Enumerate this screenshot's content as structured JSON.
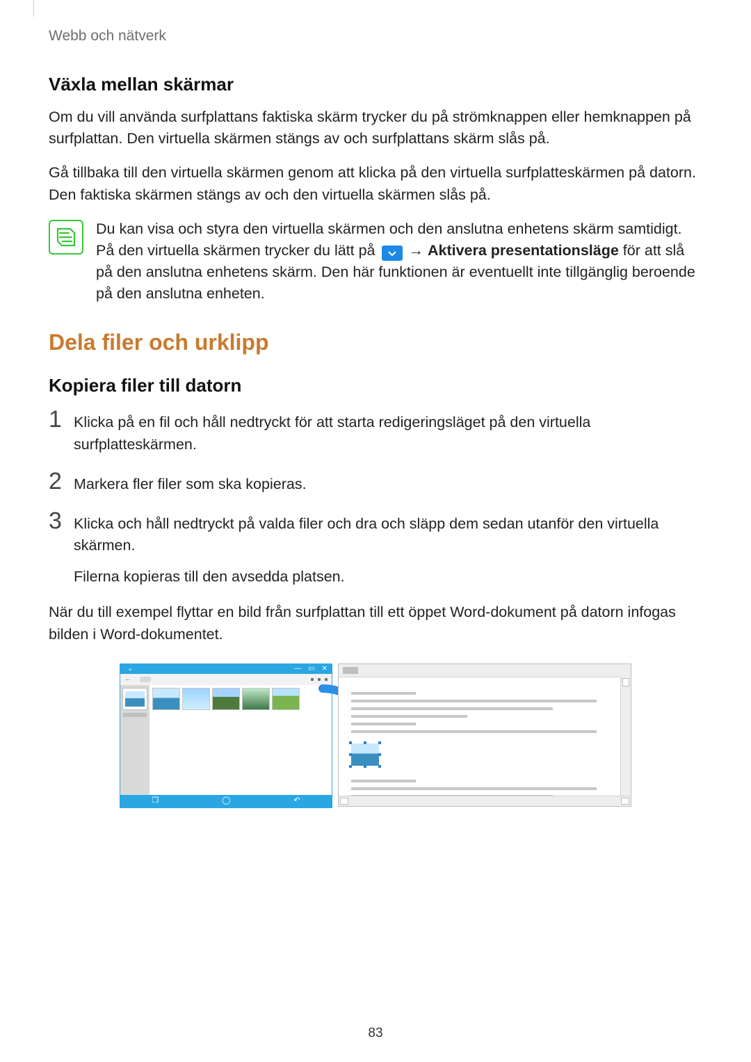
{
  "breadcrumb": "Webb och nätverk",
  "section1": {
    "title": "Växla mellan skärmar",
    "para1": "Om du vill använda surfplattans faktiska skärm trycker du på strömknappen eller hemknappen på surfplattan. Den virtuella skärmen stängs av och surfplattans skärm slås på.",
    "para2": "Gå tillbaka till den virtuella skärmen genom att klicka på den virtuella surfplatteskärmen på datorn. Den faktiska skärmen stängs av och den virtuella skärmen slås på."
  },
  "note": {
    "part1": "Du kan visa och styra den virtuella skärmen och den anslutna enhetens skärm samtidigt. På den virtuella skärmen trycker du lätt på ",
    "arrow": " → ",
    "bold": "Aktivera presentationsläge",
    "part2": " för att slå på den anslutna enhetens skärm. Den här funktionen är eventuellt inte tillgänglig beroende på den anslutna enheten."
  },
  "section2": {
    "title": "Dela filer och urklipp",
    "subtitle": "Kopiera filer till datorn",
    "steps": [
      "Klicka på en fil och håll nedtryckt för att starta redigeringsläget på den virtuella surfplatteskärmen.",
      "Markera fler filer som ska kopieras.",
      "Klicka och håll nedtryckt på valda filer och dra och släpp dem sedan utanför den virtuella skärmen."
    ],
    "step3_extra": "Filerna kopieras till den avsedda platsen.",
    "after": "När du till exempel flyttar en bild från surfplattan till ett öppet Word-dokument på datorn infogas bilden i Word-dokumentet."
  },
  "page_number": "83"
}
